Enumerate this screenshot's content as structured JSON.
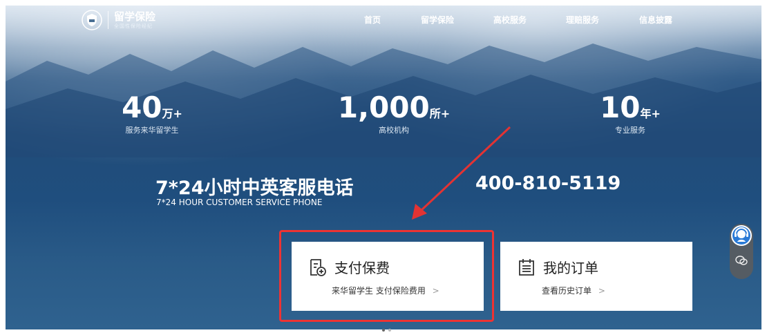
{
  "brand": {
    "name": "留学保险",
    "tagline": "全国性保险经纪"
  },
  "nav": [
    "首页",
    "留学保险",
    "高校服务",
    "理赔服务",
    "信息披露"
  ],
  "stats": [
    {
      "number": "40",
      "unit": "万+",
      "label": "服务来华留学生"
    },
    {
      "number": "1,000",
      "unit": "所+",
      "label": "高校机构"
    },
    {
      "number": "10",
      "unit": "年+",
      "label": "专业服务"
    }
  ],
  "service": {
    "title_cn": "7*24小时中英客服电话",
    "title_en": "7*24 HOUR CUSTOMER SERVICE PHONE",
    "phone": "400-810-5119"
  },
  "cards": [
    {
      "title": "支付保费",
      "subtitle": "来华留学生 支付保险费用",
      "chevron": ">"
    },
    {
      "title": "我的订单",
      "subtitle": "查看历史订单",
      "chevron": ">"
    }
  ],
  "colors": {
    "highlight": "#e33333",
    "arrow": "#e33333",
    "card_bg": "#ffffff",
    "float_bg": "#555c63",
    "agent_icon": "#2a7ad6"
  },
  "icons": [
    "shield-logo-icon",
    "pay-premium-icon",
    "order-list-icon",
    "customer-agent-icon",
    "wechat-icon"
  ]
}
